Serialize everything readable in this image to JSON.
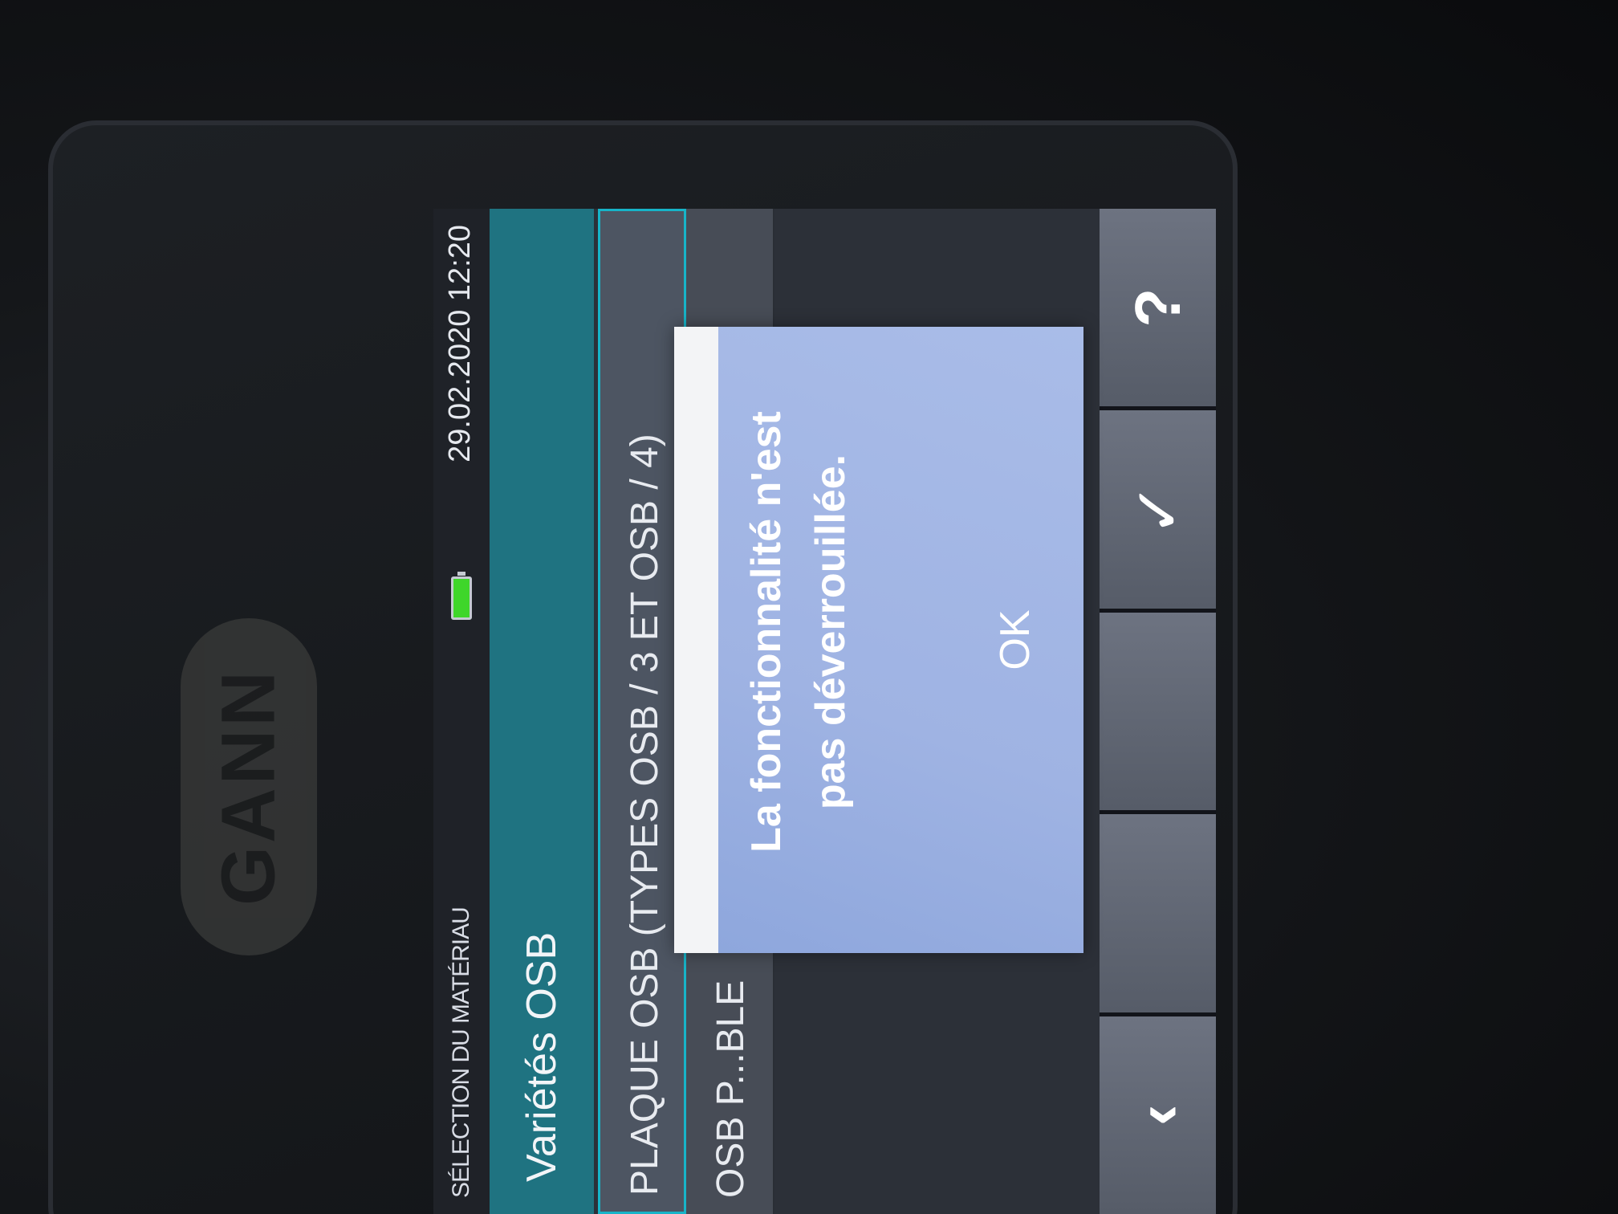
{
  "device": {
    "logo_text": "GANN"
  },
  "status_bar": {
    "title": "SÉLECTION DU MATÉRIAU",
    "datetime": "29.02.2020 12:20",
    "battery_icon": "battery-icon"
  },
  "header": {
    "title": "Variétés OSB"
  },
  "list": {
    "items": [
      {
        "label": "PLAQUE OSB (TYPES OSB / 3 ET OSB / 4)"
      },
      {
        "label": "OSB P...BLE"
      }
    ]
  },
  "softkeys": [
    {
      "icon": "chevron-left-icon",
      "glyph": "‹"
    },
    {
      "icon": "blank-icon",
      "glyph": ""
    },
    {
      "icon": "blank-icon",
      "glyph": ""
    },
    {
      "icon": "checkmark-icon",
      "glyph": "✓"
    },
    {
      "icon": "question-icon",
      "glyph": "?"
    }
  ],
  "dialog": {
    "message": "La fonctionnalité n'est pas déverrouillée.",
    "ok_label": "OK"
  },
  "colors": {
    "header_teal": "#1f7381",
    "selection_cyan": "#17b4c8",
    "dialog_blue": "#9fb3e3",
    "battery_green": "#3fd62a"
  }
}
